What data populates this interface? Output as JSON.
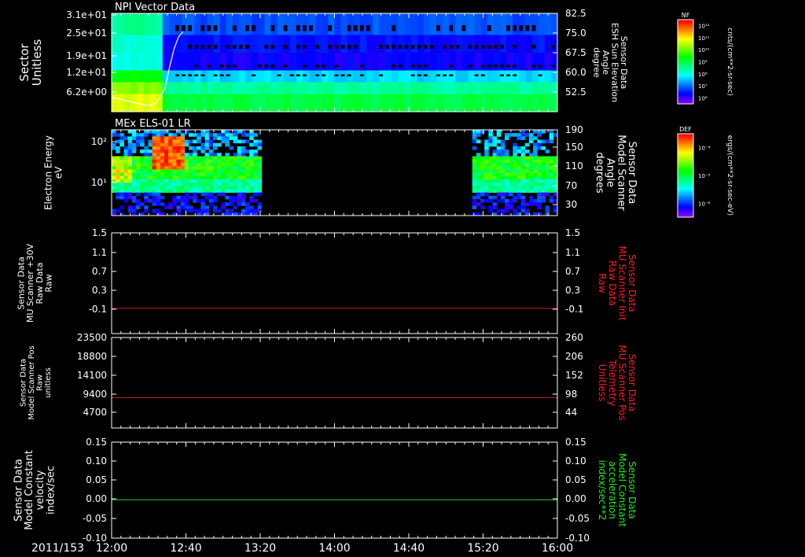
{
  "colors": {
    "background": "#000000",
    "frame": "#ffffff",
    "red_trace": "#cc2020",
    "green_trace": "#22dd22",
    "red_label": "#ff2020",
    "green_label": "#22ee22"
  },
  "colorbars": [
    {
      "label": "NF",
      "units": "cnts/(cm**2-sr-sec)",
      "ticks": [
        "10¹²",
        "10¹¹",
        "10¹⁰",
        "10⁹",
        "10⁸",
        "10⁷",
        "10⁶"
      ]
    },
    {
      "label": "DEF",
      "units": "ergs/(cm**2-sr-sec-eV)",
      "ticks": [
        "10⁻⁴",
        "10⁻⁵",
        "10⁻⁶"
      ]
    }
  ],
  "time_axis": {
    "date": "2011/153",
    "ticks": [
      "12:00",
      "12:40",
      "13:20",
      "14:00",
      "14:40",
      "15:20",
      "16:00"
    ]
  },
  "chart_data": [
    {
      "type": "heatmap",
      "title": "NPI Vector Data",
      "ylabel_left": [
        "Sector",
        "Unitless"
      ],
      "yticks_left": [
        "3.1e+01",
        "2.5e+01",
        "1.9e+01",
        "1.2e+01",
        "6.2e+00"
      ],
      "ylabel_right": [
        "Sensor Data",
        "ESH Sun Elevation",
        "Angle",
        "degree"
      ],
      "yticks_right": [
        "82.5",
        "75.0",
        "67.5",
        "60.0",
        "52.5"
      ],
      "overlay_line": {
        "x": [
          0,
          0.05,
          0.08,
          0.1,
          0.12,
          0.13,
          0.14,
          0.15,
          0.16
        ],
        "y": [
          50.5,
          48.5,
          47.3,
          48.3,
          54,
          62,
          69,
          73.5,
          75.5
        ]
      }
    },
    {
      "type": "heatmap",
      "title": "MEx ELS-01 LR",
      "ylabel_left": [
        "Electron Energy",
        "eV"
      ],
      "yticks_left": [
        "10²",
        "10¹"
      ],
      "ylabel_right": [
        "Sensor Data",
        "Model Scanner",
        "Angle",
        "degrees"
      ],
      "yticks_right": [
        "190",
        "150",
        "110",
        "70",
        "30"
      ],
      "data_gap": {
        "start": "13:20",
        "end": "15:15"
      }
    },
    {
      "type": "line",
      "ylabel_left": [
        "Sensor Data",
        "MU Scanner +30V",
        "Raw Data",
        "Raw"
      ],
      "yticks_left": [
        "1.5",
        "1.1",
        "0.7",
        "0.3",
        "-0.1"
      ],
      "ylabel_right": [
        "Sensor Data",
        "MU Scanner Init",
        "Raw Data",
        "Raw"
      ],
      "yticks_right": [
        "1.5",
        "1.1",
        "0.7",
        "0.3",
        "-0.1"
      ],
      "ylim": [
        -0.5,
        1.5
      ],
      "series": [
        {
          "x": [
            0,
            1
          ],
          "values": [
            0,
            0
          ]
        }
      ]
    },
    {
      "type": "line",
      "ylabel_left": [
        "Sensor Data",
        "Model Scanner Pos",
        "Raw",
        "unitless"
      ],
      "yticks_left": [
        "23500",
        "18800",
        "14100",
        "9400",
        "4700"
      ],
      "ylabel_right": [
        "Sensor Data",
        "MU Scanner Pos",
        "Telemetry",
        "Unitless"
      ],
      "yticks_right": [
        "260",
        "206",
        "152",
        "98",
        "44"
      ],
      "ylim": [
        0,
        23500
      ],
      "series": [
        {
          "x": [
            0,
            1
          ],
          "values": [
            7900,
            7900
          ]
        }
      ]
    },
    {
      "type": "line",
      "ylabel_left": [
        "Sensor Data",
        "Model Constant",
        "velocity",
        "index/sec"
      ],
      "yticks_left": [
        "0.15",
        "0.10",
        "0.05",
        "0.00",
        "-0.05",
        "-0.10"
      ],
      "ylabel_right": [
        "Sensor Data",
        "Model Constant",
        "acceleration",
        "index/sec**2"
      ],
      "yticks_right": [
        "0.15",
        "0.10",
        "0.05",
        "0.00",
        "-0.05",
        "-0.10"
      ],
      "ylim": [
        -0.1,
        0.15
      ],
      "series": [
        {
          "x": [
            0,
            1
          ],
          "values": [
            0,
            0
          ]
        }
      ]
    }
  ]
}
